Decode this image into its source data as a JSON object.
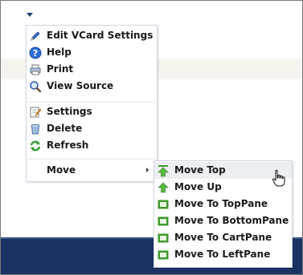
{
  "context_menu": {
    "items": [
      {
        "label": "Edit VCard Settings",
        "icon": "pencil-icon"
      },
      {
        "label": "Help",
        "icon": "help-icon"
      },
      {
        "label": "Print",
        "icon": "printer-icon"
      },
      {
        "label": "View Source",
        "icon": "magnifier-icon"
      },
      {
        "label": "Settings",
        "icon": "settings-icon"
      },
      {
        "label": "Delete",
        "icon": "trash-icon"
      },
      {
        "label": "Refresh",
        "icon": "refresh-icon"
      },
      {
        "label": "Move",
        "icon": "submenu-arrow-icon"
      }
    ]
  },
  "move_submenu": {
    "items": [
      {
        "label": "Move Top",
        "icon": "move-top-icon"
      },
      {
        "label": "Move Up",
        "icon": "move-up-icon"
      },
      {
        "label": "Move To TopPane",
        "icon": "pane-icon"
      },
      {
        "label": "Move To BottomPane",
        "icon": "pane-icon"
      },
      {
        "label": "Move To CartPane",
        "icon": "pane-icon"
      },
      {
        "label": "Move To LeftPane",
        "icon": "pane-icon"
      }
    ]
  },
  "colors": {
    "footer_band": "#1b3463",
    "menu_border": "#cfd6e2",
    "hover_background": "#eceef1",
    "pane_icon_green": "#3f9a2e"
  }
}
